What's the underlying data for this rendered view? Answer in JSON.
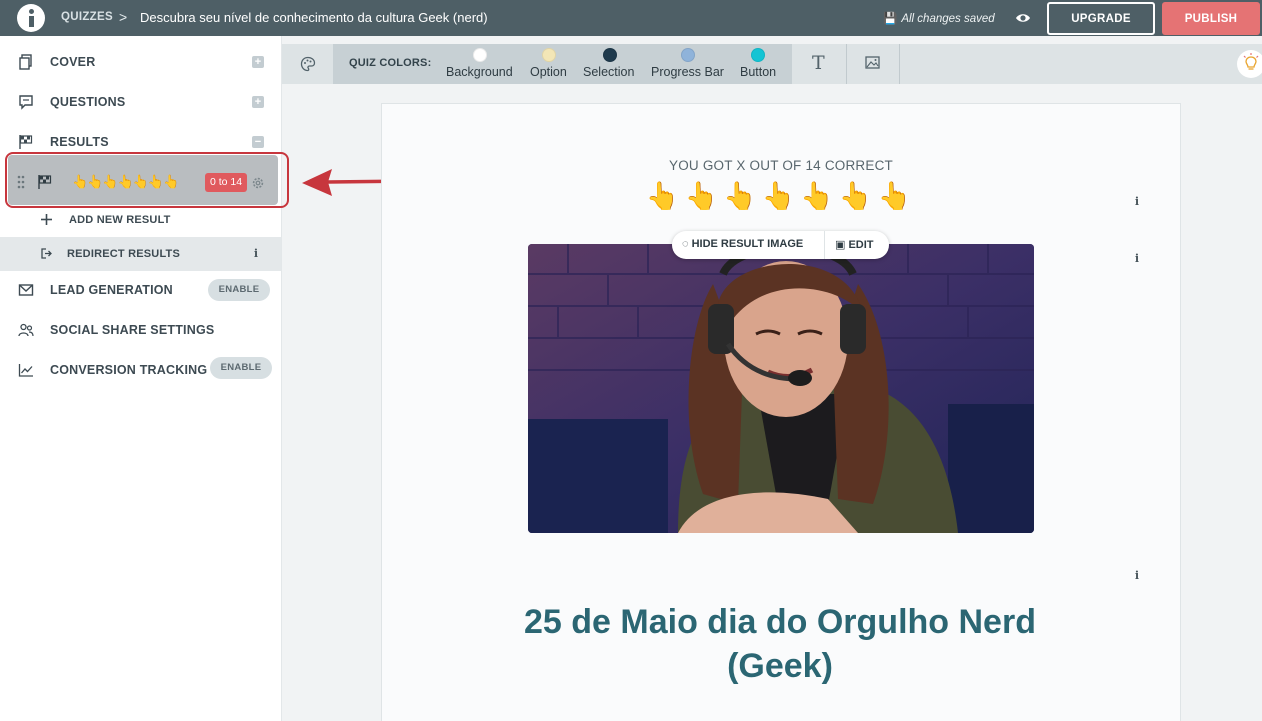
{
  "header": {
    "root_crumb": "QUIZZES",
    "separator": ">",
    "quiz_title": "Descubra seu nível de conhecimento da cultura Geek (nerd)",
    "saved_status": "All changes saved",
    "upgrade_label": "UPGRADE",
    "publish_label": "PUBLISH"
  },
  "sidebar": {
    "items": [
      {
        "label": "COVER",
        "icon": "copy-icon",
        "action": "+"
      },
      {
        "label": "QUESTIONS",
        "icon": "comment-icon",
        "action": "+"
      },
      {
        "label": "RESULTS",
        "icon": "checkered-flag-icon",
        "action": "−"
      }
    ],
    "result": {
      "label": "👆👆👆👆👆👆👆",
      "range": "0 to 14"
    },
    "add_new_result": "ADD NEW RESULT",
    "redirect_results": "REDIRECT RESULTS",
    "lead_generation": {
      "label": "LEAD GENERATION",
      "badge": "ENABLE"
    },
    "social_share": {
      "label": "SOCIAL SHARE SETTINGS"
    },
    "conversion_tracking": {
      "label": "CONVERSION TRACKING",
      "badge": "ENABLE"
    }
  },
  "toolbar": {
    "colors_label": "QUIZ COLORS:",
    "swatches": [
      {
        "label": "Background",
        "color": "#ffffff"
      },
      {
        "label": "Option",
        "color": "#f3e6b6"
      },
      {
        "label": "Selection",
        "color": "#1f3a4d"
      },
      {
        "label": "Progress Bar",
        "color": "#8fb3da"
      },
      {
        "label": "Button",
        "color": "#13c4d4"
      }
    ]
  },
  "canvas": {
    "score_text": "YOU GOT X OUT OF 14 CORRECT",
    "hands": "👆👆👆👆👆👆👆",
    "hide_image_label": "HIDE RESULT IMAGE",
    "edit_label": "EDIT",
    "result_title": "25 de Maio dia do Orgulho Nerd (Geek)"
  },
  "colors": {
    "topbar": "#4e5f66",
    "publish": "#e57374",
    "range_badge": "#e05a5e",
    "title_text": "#2b6673",
    "annotation": "#c7363d"
  }
}
